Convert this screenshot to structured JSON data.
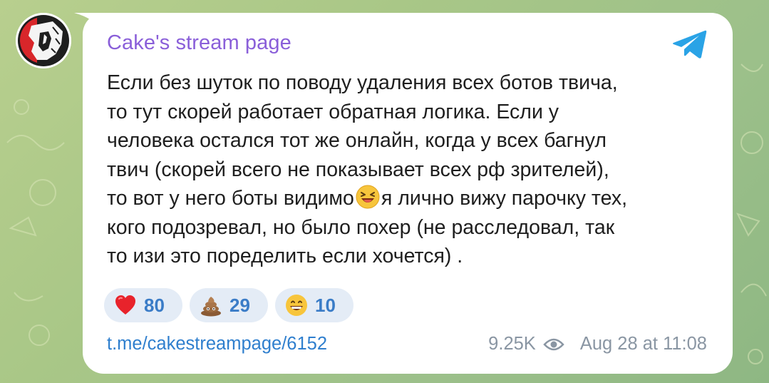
{
  "channel": {
    "title": "Cake's stream page"
  },
  "message": {
    "lines": [
      "Если без шуток по поводу удаления всех ботов твича,",
      "то тут скорей работает обратная логика. Если у",
      "человека остался тот же онлайн, когда у всех багнул",
      "твич (скорей всего не показывает всех рф зрителей),",
      "то вот у него боты видимо",
      "я лично вижу парочку тех,",
      "кого подозревал, но было похер (не расследовал, так",
      "то изи это поределить если хочется) ."
    ],
    "inline_emoji": "laughing-emoji"
  },
  "reactions": [
    {
      "emoji": "red-heart",
      "count": "80"
    },
    {
      "emoji": "pile-of-poo",
      "count": "29"
    },
    {
      "emoji": "grinning-face",
      "count": "10"
    }
  ],
  "footer": {
    "link": "t.me/cakestreampage/6152",
    "views": "9.25K",
    "timestamp": "Aug 28 at 11:08"
  },
  "icons": {
    "share": "telegram-plane-icon",
    "views": "eye-icon"
  },
  "colors": {
    "title": "#8a5fd9",
    "link": "#2f7fce",
    "reaction_bg": "#e4ecf6",
    "reaction_text": "#3a7cc7",
    "meta": "#8a96a3",
    "telegram_blue": "#2aa3e6"
  }
}
